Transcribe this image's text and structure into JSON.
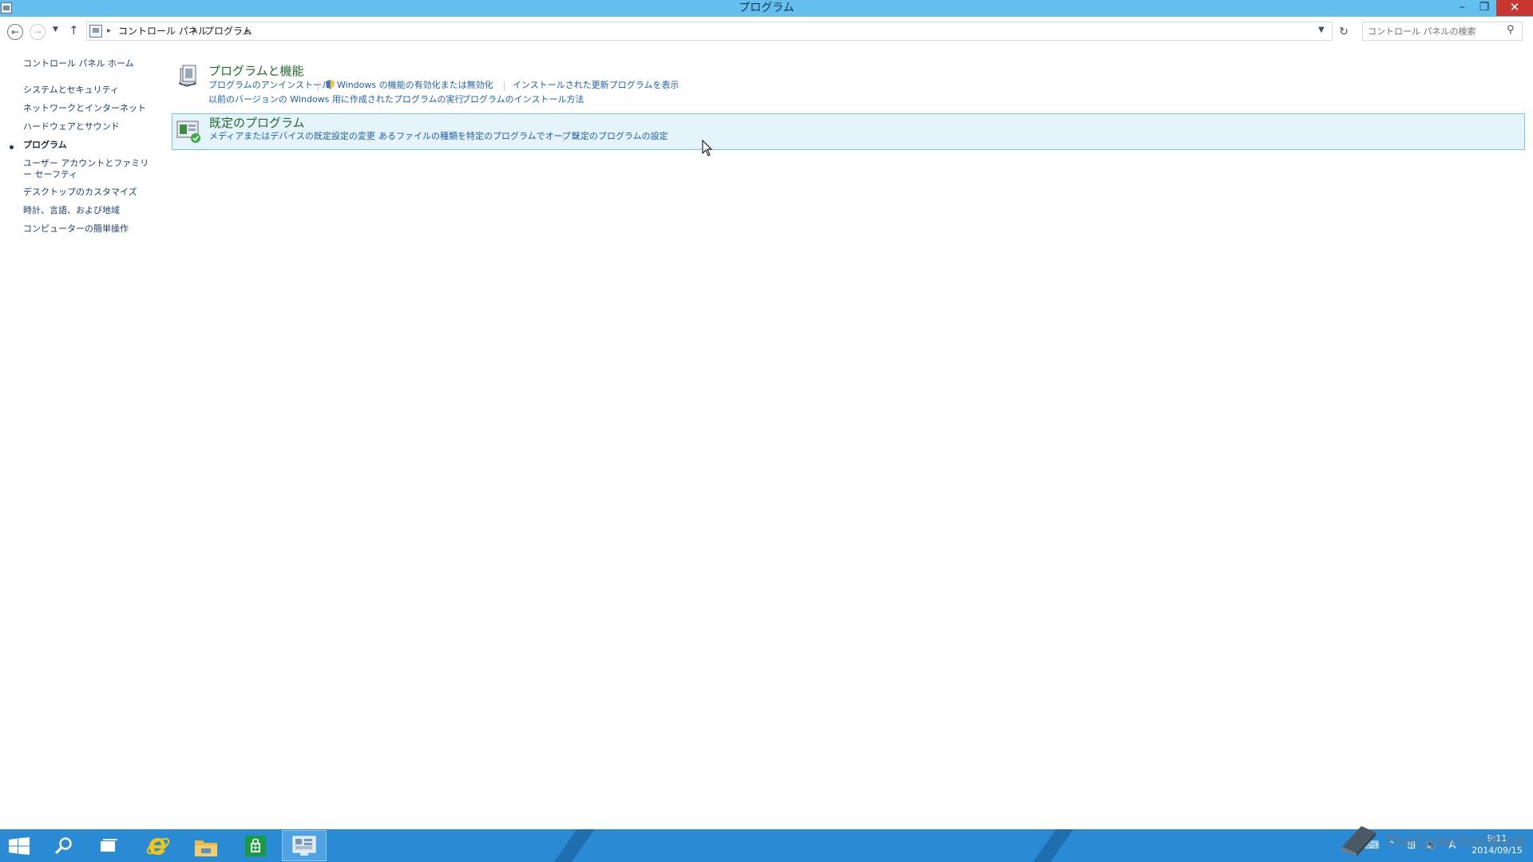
{
  "window": {
    "title": "プログラム",
    "minimize_glyph": "–",
    "maximize_glyph": "❐",
    "close_glyph": "✕"
  },
  "address_bar": {
    "breadcrumbs": [
      "コントロール パネル",
      "プログラム"
    ],
    "search_placeholder": "コントロール パネルの検索"
  },
  "sidebar": {
    "home": "コントロール パネル ホーム",
    "items": [
      {
        "label": "システムとセキュリティ"
      },
      {
        "label": "ネットワークとインターネット"
      },
      {
        "label": "ハードウェアとサウンド"
      },
      {
        "label": "プログラム",
        "active": true
      },
      {
        "label": "ユーザー アカウントとファミリー セーフティ"
      },
      {
        "label": "デスクトップのカスタマイズ"
      },
      {
        "label": "時計、言語、および地域"
      },
      {
        "label": "コンピューターの簡単操作"
      }
    ]
  },
  "categories": [
    {
      "title": "プログラムと機能",
      "links": [
        "プログラムのアンインストール",
        "Windows の機能の有効化または無効化",
        "インストールされた更新プログラムを表示",
        "以前のバージョンの Windows 用に作成されたプログラムの実行",
        "プログラムのインストール方法"
      ]
    },
    {
      "title": "既定のプログラム",
      "links": [
        "メディアまたはデバイスの既定設定の変更",
        "あるファイルの種類を特定のプログラムでオープン",
        "既定のプログラムの設定"
      ]
    }
  ],
  "taskbar": {
    "apps": [
      "start",
      "search",
      "task-view",
      "internet-explorer",
      "file-explorer",
      "store",
      "control-panel"
    ],
    "ime_label": "A",
    "clock_time": "9:11",
    "clock_date": "2014/09/15"
  },
  "watermark": "TheCollectionBook",
  "colors": {
    "titlebar": "#64bfee",
    "taskbar": "#2a8ad4",
    "link": "#1a5fb4",
    "category_title": "#1f6a2a",
    "hover_bg": "#e5f3fb"
  }
}
